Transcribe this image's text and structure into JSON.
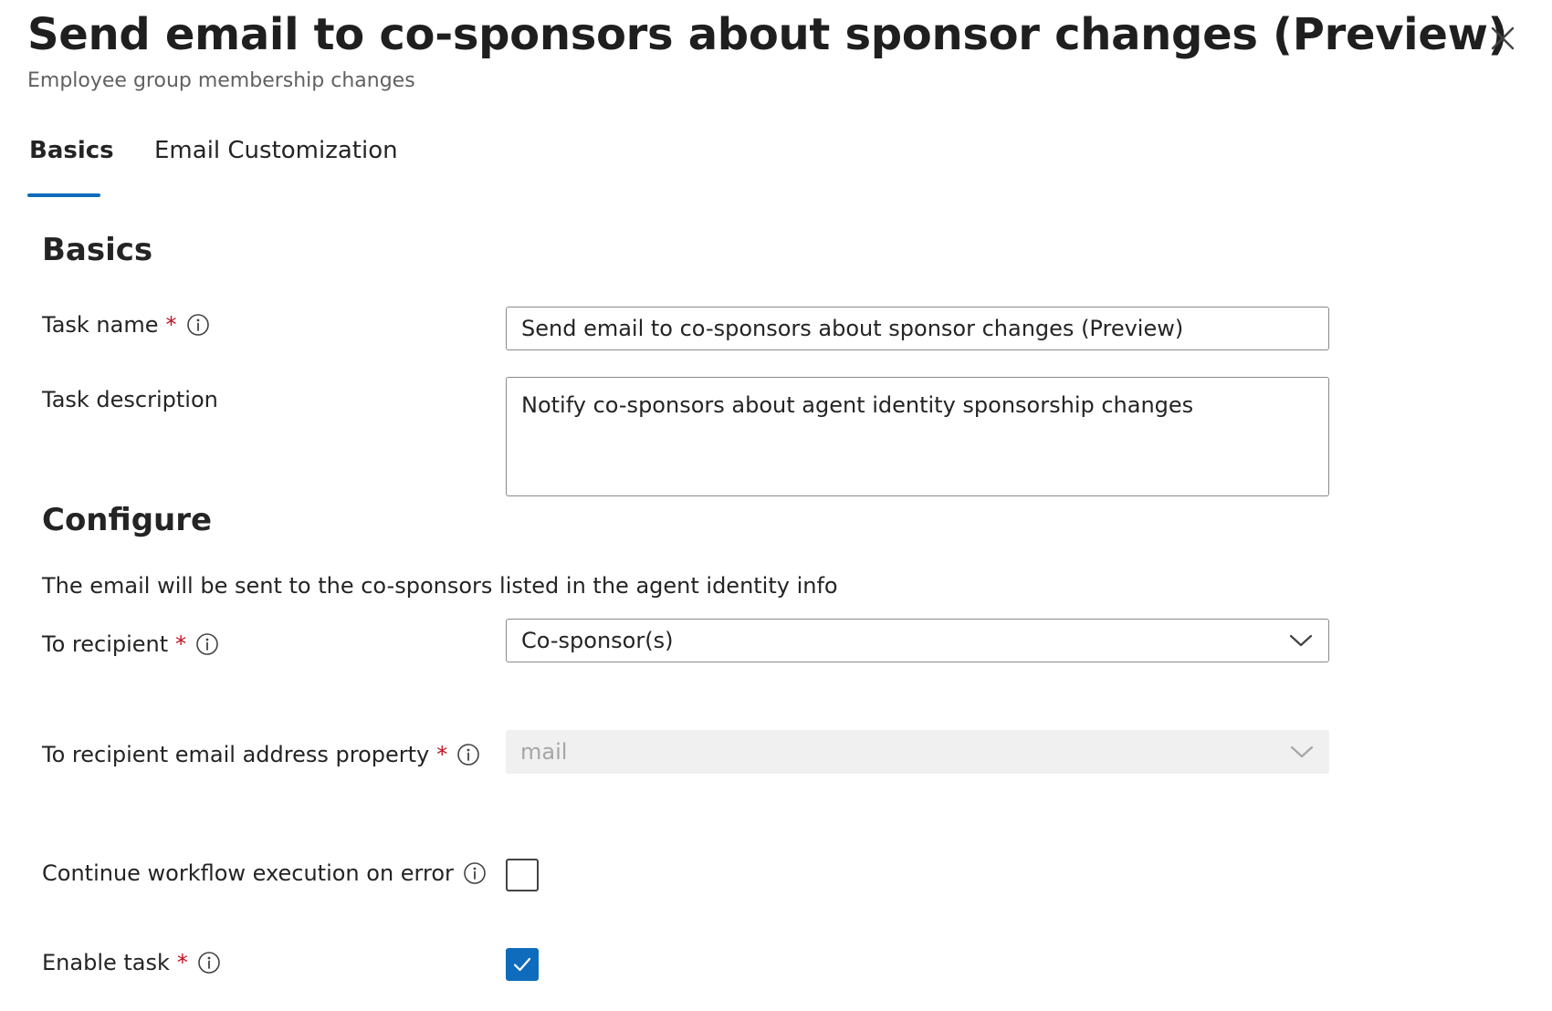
{
  "panel": {
    "title": "Send email to co-sponsors about sponsor changes (Preview)",
    "subtitle": "Employee group membership changes"
  },
  "tabs": [
    {
      "label": "Basics",
      "active": true
    },
    {
      "label": "Email Customization",
      "active": false
    }
  ],
  "basics": {
    "heading": "Basics",
    "task_name": {
      "label": "Task name",
      "required_mark": "*",
      "value": "Send email to co-sponsors about sponsor changes (Preview)"
    },
    "task_description": {
      "label": "Task description",
      "value": "Notify co-sponsors about agent identity sponsorship changes"
    }
  },
  "configure": {
    "heading": "Configure",
    "intro": "The email will be sent to the co-sponsors listed in the agent identity info",
    "to_recipient": {
      "label": "To recipient",
      "required_mark": "*",
      "selected": "Co-sponsor(s)"
    },
    "email_property": {
      "label": "To recipient email address property",
      "required_mark": "*",
      "selected": "mail",
      "disabled": true
    },
    "continue_on_error": {
      "label": "Continue workflow execution on error",
      "checked": false
    },
    "enable_task": {
      "label": "Enable task",
      "required_mark": "*",
      "checked": true
    }
  },
  "colors": {
    "accent": "#0f6cbd",
    "required": "#c50f1f",
    "disabled_bg": "#f0f0f0"
  },
  "icons": {
    "close": "close-icon",
    "info": "info-icon",
    "dropdown": "chevron-down-icon",
    "check": "checkmark-icon"
  }
}
